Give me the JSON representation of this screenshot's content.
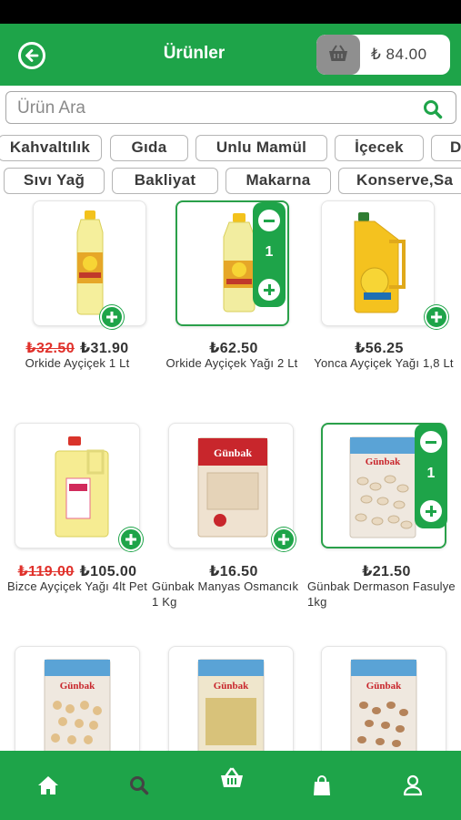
{
  "header": {
    "title": "Ürünler",
    "cart_total": "₺ 84.00"
  },
  "search": {
    "placeholder": "Ürün Ara"
  },
  "categories_row1": [
    "Kahvaltılık",
    "Gıda",
    "Unlu Mamül",
    "İçecek",
    "D"
  ],
  "categories_row2": [
    "Sıvı Yağ",
    "Bakliyat",
    "Makarna",
    "Konserve,Sa"
  ],
  "products": [
    {
      "old_price": "₺32.50",
      "price": "₺31.90",
      "name": "Orkide Ayçiçek  1 Lt"
    },
    {
      "price": "₺62.50",
      "name": "Orkide Ayçiçek Yağı  2 Lt",
      "qty": "1"
    },
    {
      "price": "₺56.25",
      "name": "Yonca Ayçiçek Yağı 1,8 Lt"
    },
    {
      "old_price": "₺119.00",
      "price": "₺105.00",
      "name": "Bizce Ayçiçek Yağı 4lt Pet"
    },
    {
      "price": "₺16.50",
      "name": "Günbak Manyas Osmancık 1 Kg"
    },
    {
      "price": "₺21.50",
      "name": "Günbak Dermason Fasulye 1kg",
      "qty": "1"
    }
  ],
  "nav_icons": [
    "home-icon",
    "search-icon",
    "basket-icon",
    "bag-icon",
    "user-icon"
  ],
  "colors": {
    "brand": "#1ea449",
    "discount": "#e0312b"
  }
}
